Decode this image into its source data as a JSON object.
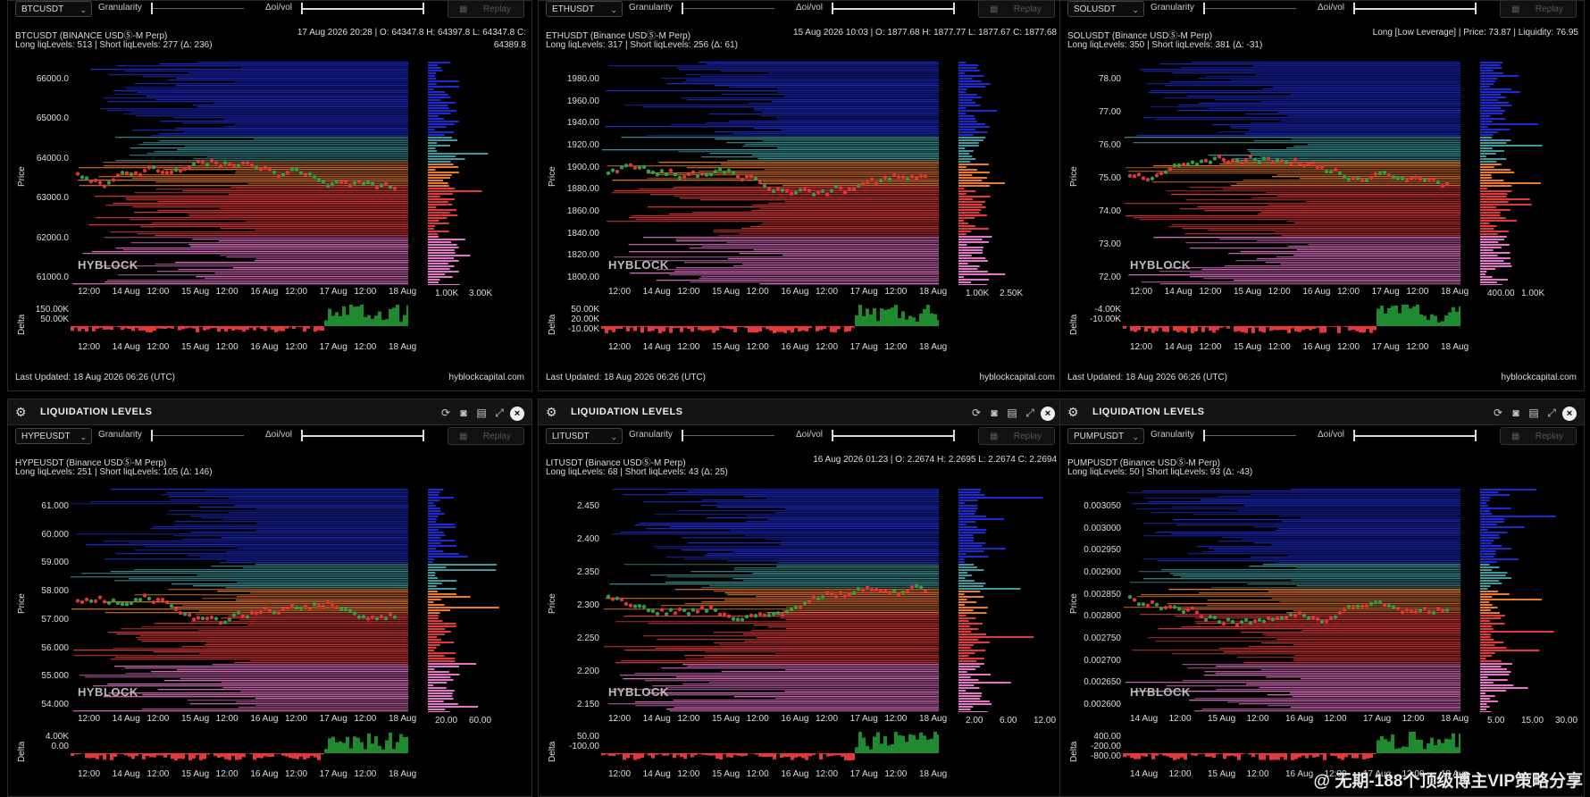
{
  "header_title": "LIQUIDATION LEVELS",
  "labels": {
    "granularity": "Granularity",
    "doi": "Δoi/vol",
    "replay": "Replay",
    "price": "Price",
    "delta": "Delta",
    "watermark": "HYBLOCK",
    "site": "hyblockcapital.com"
  },
  "colors": {
    "blue": "#1c2bd6",
    "teal": "#3a9ba0",
    "orange": "#f07b20",
    "red": "#e8373a",
    "pink": "#e774c9",
    "green": "#1f8a2f",
    "candle_up": "#2aa04a",
    "candle_down": "#e03535"
  },
  "panels": [
    {
      "symbol": "BTCUSDT",
      "line1": "BTCUSDT (BINANCE USDⓈ-M Perp)",
      "line2": "Long liqLevels: 513 | Short liqLevels: 277 (Δ: 236)",
      "right1": "17 Aug 2026 20:28 | O: 64347.8 H: 64397.8 L: 64347.8 C:",
      "right2": "64389.8",
      "yticks": [
        "66000.0",
        "65000.0",
        "64000.0",
        "63000.0",
        "62000.0",
        "61000.0"
      ],
      "xticks": [
        "12:00",
        "14 Aug",
        "12:00",
        "15 Aug",
        "12:00",
        "16 Aug",
        "12:00",
        "17 Aug",
        "12:00",
        "18 Aug"
      ],
      "histticks": [
        "1.00K",
        "3.00K"
      ],
      "deltaticks": [
        "150.00K",
        "50.00K"
      ],
      "footer": "Last Updated: 18 Aug 2026 06:26 (UTC)"
    },
    {
      "symbol": "ETHUSDT",
      "line1": "ETHUSDT (Binance USDⓈ-M Perp)",
      "line2": "Long liqLevels: 317 | Short liqLevels: 256 (Δ: 61)",
      "right1": "15 Aug 2026 10:03 | O: 1877.68 H: 1877.77 L: 1877.67 C: 1877.68",
      "right2": "",
      "yticks": [
        "1980.00",
        "1960.00",
        "1940.00",
        "1920.00",
        "1900.00",
        "1880.00",
        "1860.00",
        "1840.00",
        "1820.00",
        "1800.00"
      ],
      "xticks": [
        "12:00",
        "14 Aug",
        "12:00",
        "15 Aug",
        "12:00",
        "16 Aug",
        "12:00",
        "17 Aug",
        "12:00",
        "18 Aug"
      ],
      "histticks": [
        "1.00K",
        "2.50K"
      ],
      "deltaticks": [
        "50.00K",
        "20.00K",
        "-10.00K"
      ],
      "footer": "Last Updated: 18 Aug 2026 06:26 (UTC)"
    },
    {
      "symbol": "SOLUSDT",
      "line1": "SOLUSDT (Binance USDⓈ-M Perp)",
      "line2": "Long liqLevels: 350 | Short liqLevels: 381 (Δ: -31)",
      "right1": "Long [Low Leverage] | Price: 73.87 | Liquidity: 76.95",
      "right2": "",
      "yticks": [
        "78.00",
        "77.00",
        "76.00",
        "75.00",
        "74.00",
        "73.00",
        "72.00"
      ],
      "xticks": [
        "12:00",
        "14 Aug",
        "12:00",
        "15 Aug",
        "12:00",
        "16 Aug",
        "12:00",
        "17 Aug",
        "12:00",
        "18 Aug"
      ],
      "histticks": [
        "400.00",
        "1.00K"
      ],
      "deltaticks": [
        "-4.00K",
        "-10.00K"
      ],
      "footer": "Last Updated: 18 Aug 2026 06:26 (UTC)"
    },
    {
      "symbol": "HYPEUSDT",
      "line1": "HYPEUSDT (Binance USDⓈ-M Perp)",
      "line2": "Long liqLevels: 251 | Short liqLevels: 105 (Δ: 146)",
      "right1": "",
      "right2": "",
      "yticks": [
        "61.000",
        "60.000",
        "59.000",
        "58.000",
        "57.000",
        "56.000",
        "55.000",
        "54.000"
      ],
      "xticks": [
        "12:00",
        "14 Aug",
        "12:00",
        "15 Aug",
        "12:00",
        "16 Aug",
        "12:00",
        "17 Aug",
        "12:00",
        "18 Aug"
      ],
      "histticks": [
        "20.00",
        "60.00"
      ],
      "deltaticks": [
        "4.00K",
        "0.00"
      ],
      "footer": ""
    },
    {
      "symbol": "LITUSDT",
      "line1": "LITUSDT (Binance USDⓈ-M Perp)",
      "line2": "Long liqLevels: 68 | Short liqLevels: 43 (Δ: 25)",
      "right1": "16 Aug 2026 01:23 | O: 2.2674 H: 2.2695 L: 2.2674 C: 2.2694",
      "right2": "",
      "yticks": [
        "2.450",
        "2.400",
        "2.350",
        "2.300",
        "2.250",
        "2.200",
        "2.150"
      ],
      "xticks": [
        "12:00",
        "14 Aug",
        "12:00",
        "15 Aug",
        "12:00",
        "16 Aug",
        "12:00",
        "17 Aug",
        "12:00",
        "18 Aug"
      ],
      "histticks": [
        "2.00",
        "6.00",
        "12.00"
      ],
      "deltaticks": [
        "50.00",
        "-100.00"
      ],
      "footer": ""
    },
    {
      "symbol": "PUMPUSDT",
      "line1": "PUMPUSDT (Binance USDⓈ-M Perp)",
      "line2": "Long liqLevels: 50 | Short liqLevels: 93 (Δ: -43)",
      "right1": "",
      "right2": "",
      "yticks": [
        "0.003050",
        "0.003000",
        "0.002950",
        "0.002900",
        "0.002850",
        "0.002800",
        "0.002750",
        "0.002700",
        "0.002650",
        "0.002600"
      ],
      "xticks": [
        "14 Aug",
        "12:00",
        "15 Aug",
        "12:00",
        "16 Aug",
        "12:00",
        "17 Aug",
        "12:00",
        "18 Aug"
      ],
      "histticks": [
        "5.00",
        "15.00",
        "30.00"
      ],
      "deltaticks": [
        "400.00",
        "-200.00",
        "-800.00"
      ],
      "footer": ""
    }
  ],
  "global_watermark": "@ 无期-188个顶级博主VIP策略分享"
}
